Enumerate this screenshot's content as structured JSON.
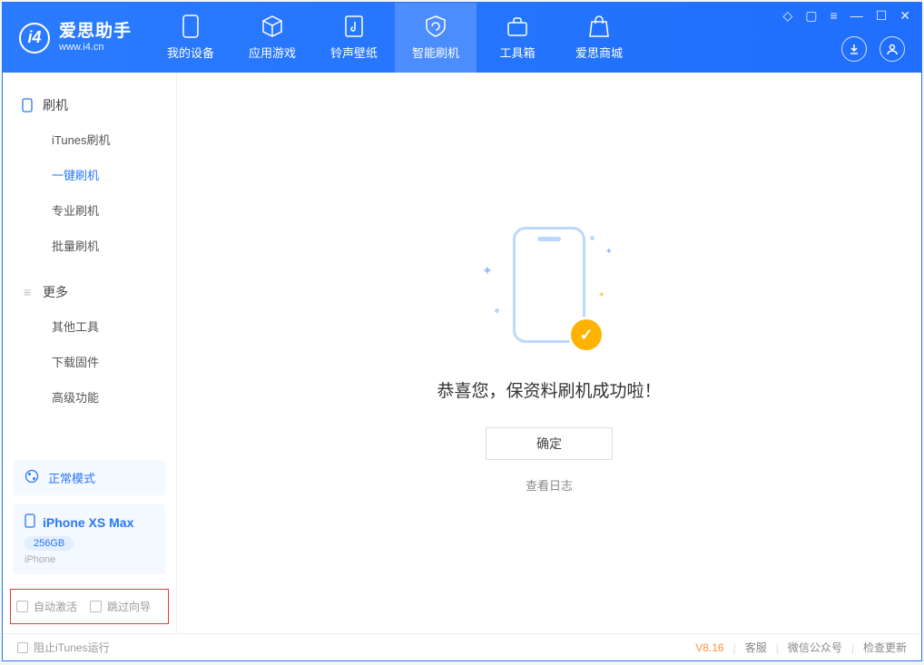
{
  "app": {
    "name_cn": "爱思助手",
    "name_en": "www.i4.cn"
  },
  "tabs": [
    {
      "label": "我的设备"
    },
    {
      "label": "应用游戏"
    },
    {
      "label": "铃声壁纸"
    },
    {
      "label": "智能刷机"
    },
    {
      "label": "工具箱"
    },
    {
      "label": "爱思商城"
    }
  ],
  "sidebar": {
    "group1": {
      "title": "刷机",
      "items": [
        "iTunes刷机",
        "一键刷机",
        "专业刷机",
        "批量刷机"
      ]
    },
    "group2": {
      "title": "更多",
      "items": [
        "其他工具",
        "下载固件",
        "高级功能"
      ]
    },
    "mode_label": "正常模式",
    "device": {
      "name": "iPhone XS Max",
      "capacity": "256GB",
      "sub": "iPhone"
    },
    "check1": "自动激活",
    "check2": "跳过向导"
  },
  "main": {
    "success_title": "恭喜您，保资料刷机成功啦！",
    "confirm": "确定",
    "view_log": "查看日志"
  },
  "footer": {
    "block_itunes": "阻止iTunes运行",
    "version": "V8.16",
    "link1": "客服",
    "link2": "微信公众号",
    "link3": "检查更新"
  }
}
